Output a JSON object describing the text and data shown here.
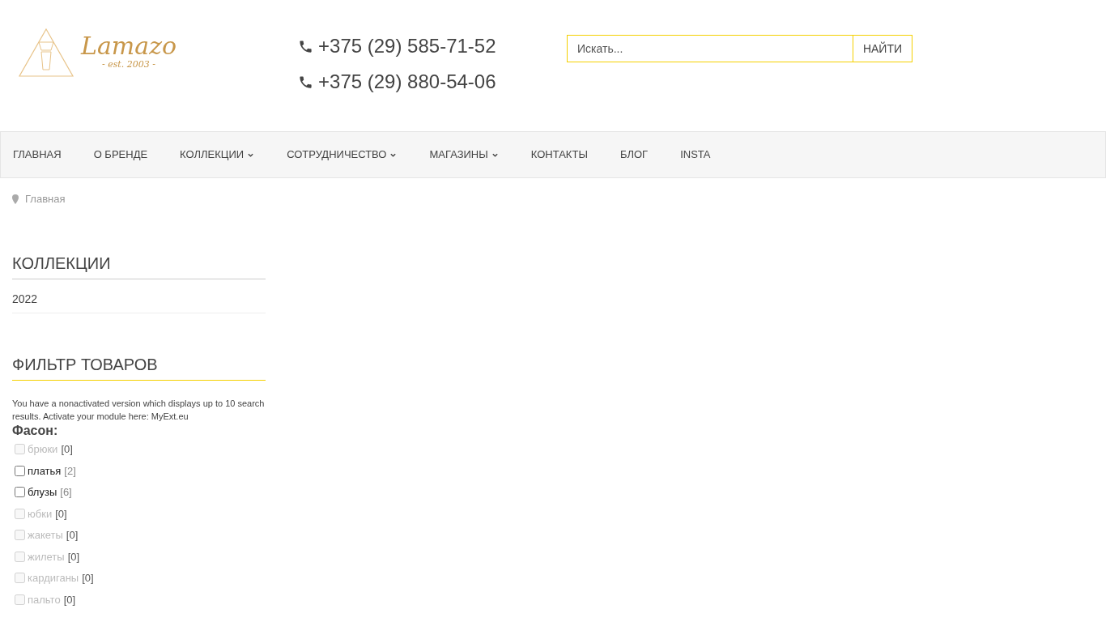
{
  "logo": {
    "name": "Lamazo",
    "tagline": "- est. 2003 -"
  },
  "phones": [
    "+375 (29) 585-71-52",
    "+375 (29) 880-54-06"
  ],
  "search": {
    "placeholder": "Искать...",
    "button": "НАЙТИ"
  },
  "nav": [
    {
      "label": "ГЛАВНАЯ",
      "dropdown": false
    },
    {
      "label": "О БРЕНДЕ",
      "dropdown": false
    },
    {
      "label": "КОЛЛЕКЦИИ",
      "dropdown": true
    },
    {
      "label": "СОТРУДНИЧЕСТВО",
      "dropdown": true
    },
    {
      "label": "МАГАЗИНЫ",
      "dropdown": true
    },
    {
      "label": "КОНТАКТЫ",
      "dropdown": false
    },
    {
      "label": "БЛОГ",
      "dropdown": false
    },
    {
      "label": "INSTA",
      "dropdown": false
    }
  ],
  "breadcrumb": [
    "Главная"
  ],
  "collections": {
    "title": "КОЛЛЕКЦИИ",
    "items": [
      "2022"
    ]
  },
  "filter": {
    "title": "ФИЛЬТР ТОВАРОВ",
    "notice": "You have a nonactivated version which displays up to 10 search results. Activate your module here: MyExt.eu",
    "group": "Фасон:",
    "options": [
      {
        "label": "брюки",
        "count": "[0]",
        "disabled": true,
        "checked": false
      },
      {
        "label": "платья",
        "count": "[2]",
        "disabled": false,
        "checked": false
      },
      {
        "label": "блузы",
        "count": "[6]",
        "disabled": false,
        "checked": false
      },
      {
        "label": "юбки",
        "count": "[0]",
        "disabled": true,
        "checked": false
      },
      {
        "label": "жакеты",
        "count": "[0]",
        "disabled": true,
        "checked": false
      },
      {
        "label": "жилеты",
        "count": "[0]",
        "disabled": true,
        "checked": false
      },
      {
        "label": "кардиганы",
        "count": "[0]",
        "disabled": true,
        "checked": false
      },
      {
        "label": "пальто",
        "count": "[0]",
        "disabled": true,
        "checked": false
      }
    ]
  }
}
